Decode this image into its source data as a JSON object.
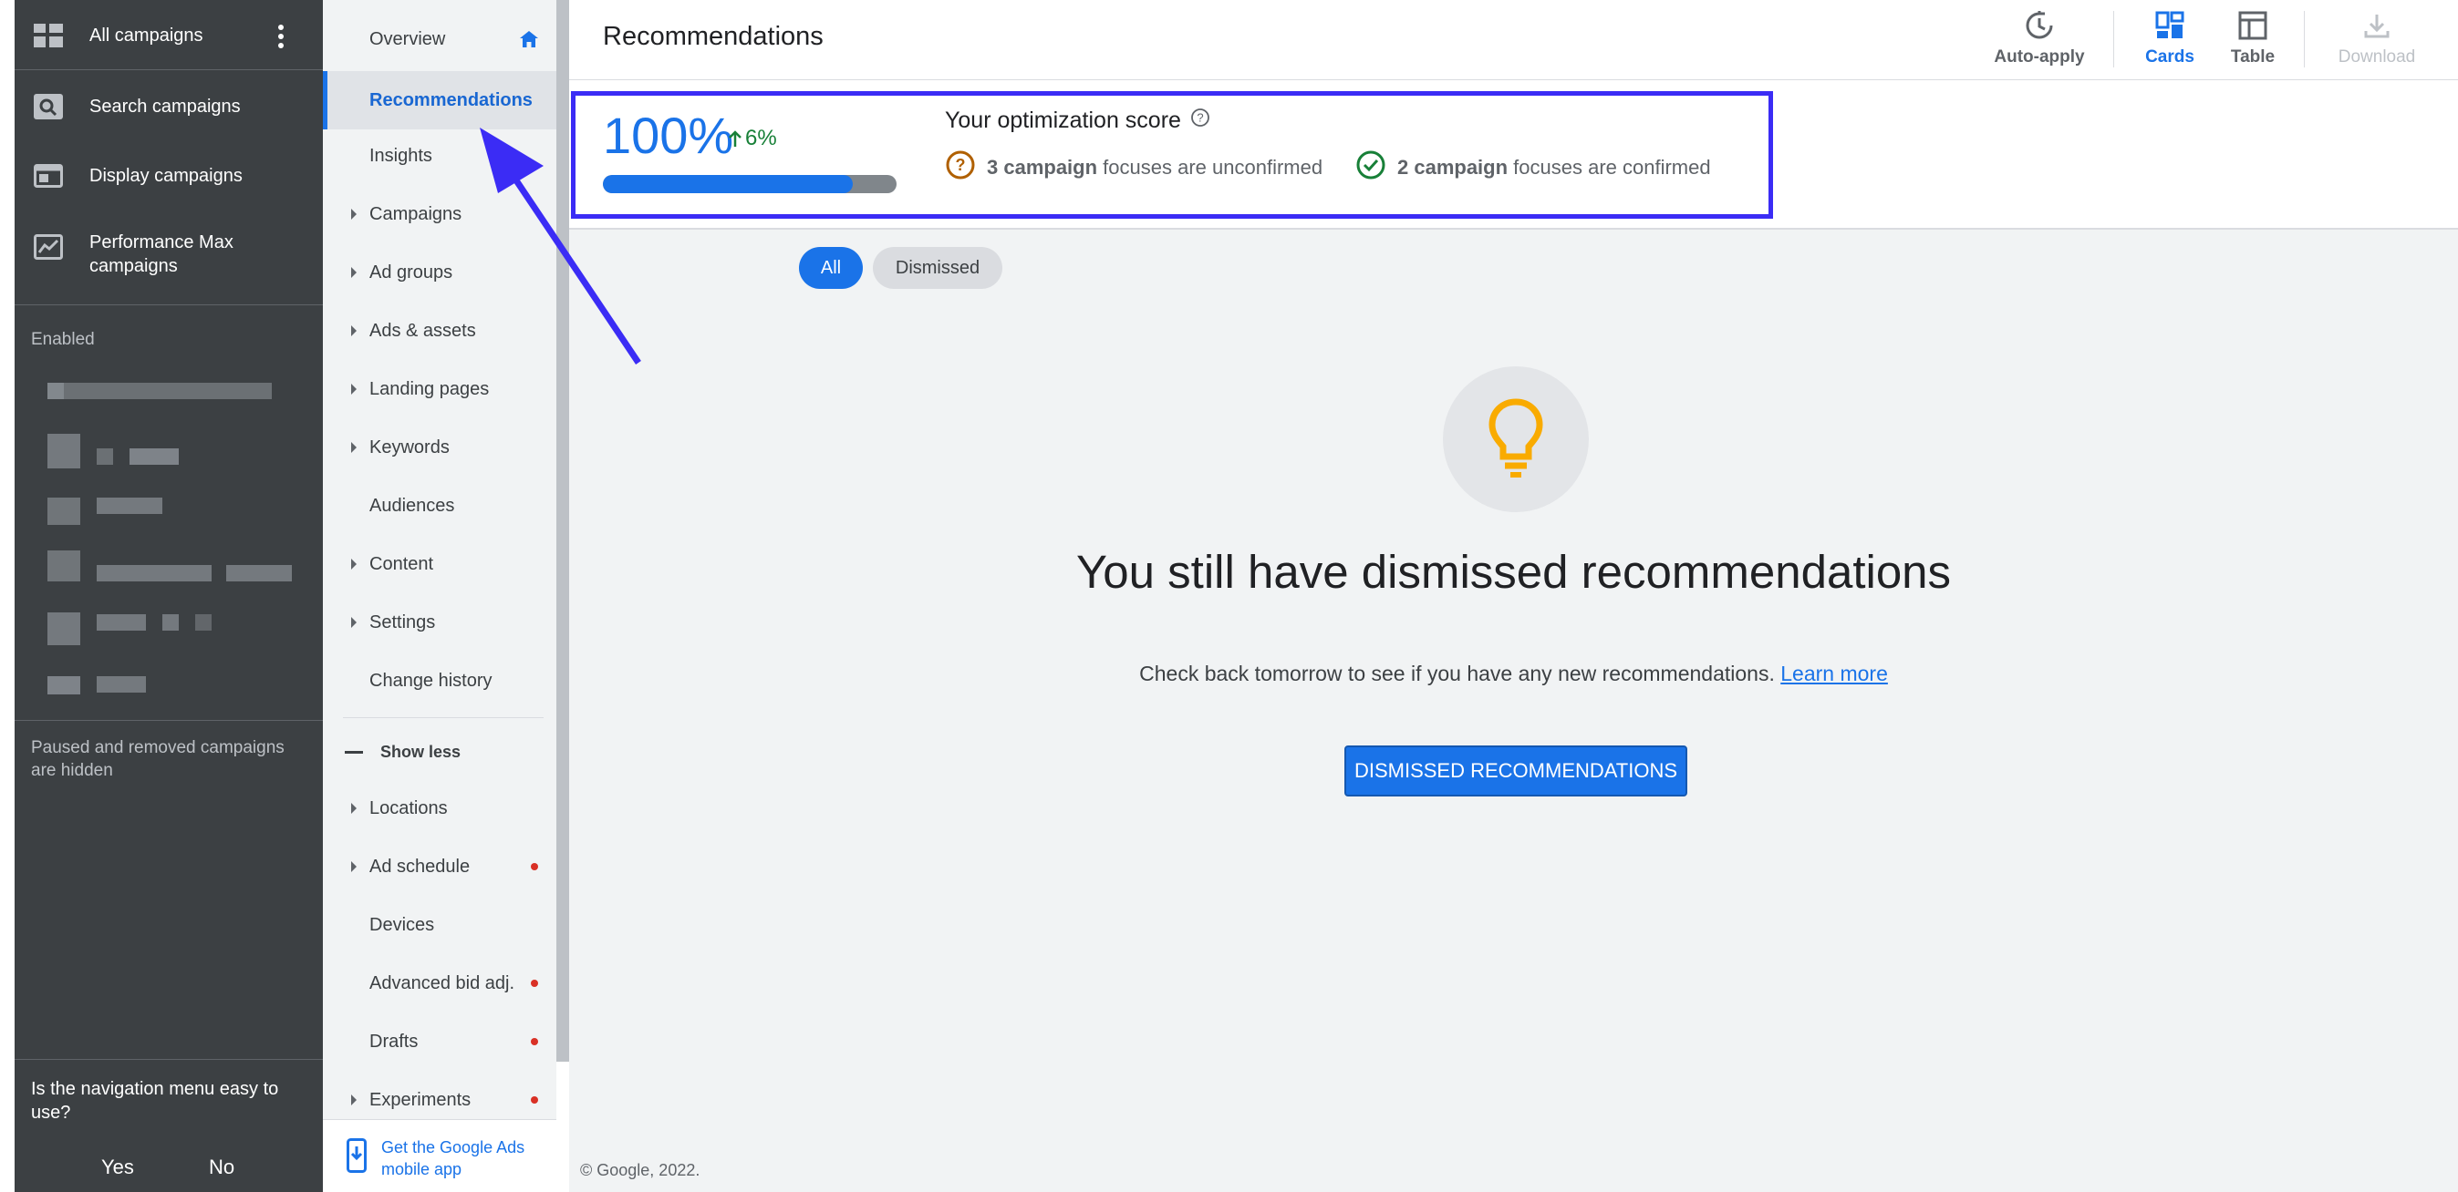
{
  "left_panel": {
    "items": [
      {
        "label": "All campaigns",
        "icon": "grid-icon"
      },
      {
        "label": "Search campaigns",
        "icon": "search-campaign-icon"
      },
      {
        "label": "Display campaigns",
        "icon": "display-campaign-icon"
      },
      {
        "label": "Performance Max campaigns",
        "icon": "performance-max-icon"
      }
    ],
    "enabled_label": "Enabled",
    "hidden_note": "Paused and removed campaigns are hidden",
    "feedback_question": "Is the navigation menu easy to use?",
    "yes": "Yes",
    "no": "No"
  },
  "nav": {
    "items": [
      {
        "label": "Overview"
      },
      {
        "label": "Recommendations"
      },
      {
        "label": "Insights"
      },
      {
        "label": "Campaigns"
      },
      {
        "label": "Ad groups"
      },
      {
        "label": "Ads & assets"
      },
      {
        "label": "Landing pages"
      },
      {
        "label": "Keywords"
      },
      {
        "label": "Audiences"
      },
      {
        "label": "Content"
      },
      {
        "label": "Settings"
      },
      {
        "label": "Change history"
      },
      {
        "label": "Show less"
      },
      {
        "label": "Locations"
      },
      {
        "label": "Ad schedule"
      },
      {
        "label": "Devices"
      },
      {
        "label": "Advanced bid adj."
      },
      {
        "label": "Drafts"
      },
      {
        "label": "Experiments"
      }
    ],
    "mobile_app": "Get the Google Ads mobile app"
  },
  "main": {
    "title": "Recommendations",
    "tools": {
      "auto_apply": "Auto-apply",
      "cards": "Cards",
      "table": "Table",
      "download": "Download"
    },
    "score": {
      "value": "100%",
      "delta": "6%",
      "fill_percent": 85,
      "title": "Your optimization score",
      "unconfirmed_count": "3 campaign",
      "unconfirmed_text": "focuses are unconfirmed",
      "confirmed_count": "2 campaign",
      "confirmed_text": "focuses are confirmed"
    },
    "chips": {
      "all": "All",
      "dismissed": "Dismissed"
    },
    "empty": {
      "title": "You still have dismissed recommendations",
      "subtitle": "Check back tomorrow to see if you have any new recommendations.",
      "link": "Learn more",
      "button": "DISMISSED RECOMMENDATIONS"
    },
    "footer": "© Google, 2022."
  },
  "colors": {
    "accent": "#1a73e8",
    "highlight": "#3b2cf5",
    "positive": "#188038",
    "warning": "#b06000",
    "alert_dot": "#d93025"
  }
}
